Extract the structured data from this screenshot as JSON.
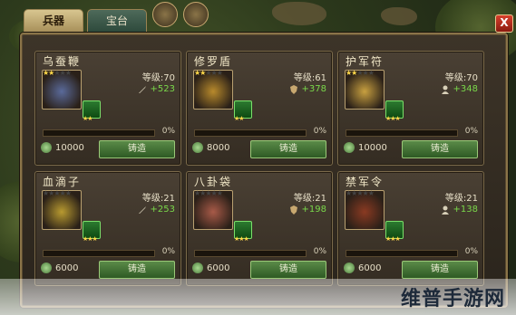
{
  "tabs": [
    {
      "label": "兵器",
      "active": true
    },
    {
      "label": "宝台",
      "active": false
    }
  ],
  "close_label": "X",
  "forge_label": "铸造",
  "items": [
    {
      "name": "乌蚕鞭",
      "stars": 2,
      "max_stars": 5,
      "level": "等级:70",
      "stat": "+523",
      "stat_icon": "sword-icon",
      "gem_stars": 2,
      "progress": 0,
      "pct": "0%",
      "cost": "10000",
      "color": "#5a6a9a"
    },
    {
      "name": "修罗盾",
      "stars": 2,
      "max_stars": 5,
      "level": "等级:61",
      "stat": "+378",
      "stat_icon": "shield-icon",
      "gem_stars": 2,
      "progress": 0,
      "pct": "0%",
      "cost": "8000",
      "color": "#b88a2c"
    },
    {
      "name": "护军符",
      "stars": 2,
      "max_stars": 5,
      "level": "等级:70",
      "stat": "+348",
      "stat_icon": "person-icon",
      "gem_stars": 3,
      "progress": 0,
      "pct": "0%",
      "cost": "10000",
      "color": "#c8a040"
    },
    {
      "name": "血滴子",
      "stars": 0,
      "max_stars": 5,
      "level": "等级:21",
      "stat": "+253",
      "stat_icon": "sword-icon",
      "gem_stars": 3,
      "progress": 0,
      "pct": "0%",
      "cost": "6000",
      "color": "#b89a30"
    },
    {
      "name": "八卦袋",
      "stars": 0,
      "max_stars": 5,
      "level": "等级:21",
      "stat": "+198",
      "stat_icon": "shield-icon",
      "gem_stars": 3,
      "progress": 0,
      "pct": "0%",
      "cost": "6000",
      "color": "#a85a48"
    },
    {
      "name": "禁军令",
      "stars": 0,
      "max_stars": 5,
      "level": "等级:21",
      "stat": "+138",
      "stat_icon": "person-icon",
      "gem_stars": 3,
      "progress": 0,
      "pct": "0%",
      "cost": "6000",
      "color": "#8a3a22"
    }
  ],
  "watermark": "维普手游网"
}
